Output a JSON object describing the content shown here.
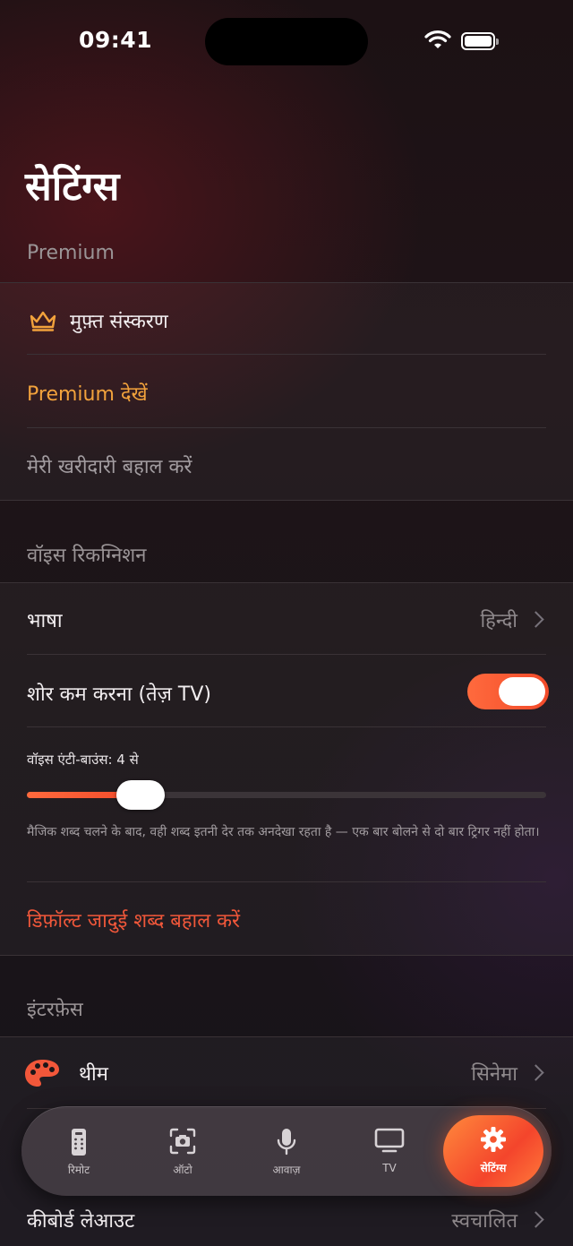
{
  "status_bar": {
    "time": "09:41"
  },
  "page": {
    "title": "सेटिंग्स"
  },
  "premium": {
    "header": "Premium",
    "version": "मुफ़्त संस्करण",
    "view_premium": "Premium देखें",
    "restore": "मेरी खरीदारी बहाल करें"
  },
  "voice": {
    "header": "वॉइस रिकग्निशन",
    "language_label": "भाषा",
    "language_value": "हिन्दी",
    "noise_label": "शोर कम करना (तेज़ TV)",
    "noise_enabled": true,
    "antibounce_label": "वॉइस एंटी-बाउंस: 4 से",
    "antibounce_fraction": 0.19,
    "antibounce_note": "मैजिक शब्द चलने के बाद, वही शब्द इतनी देर तक अनदेखा रहता है — एक बार बोलने से दो बार ट्रिगर नहीं होता।",
    "reset_magic": "डिफ़ॉल्ट जादुई शब्द बहाल करें"
  },
  "interface": {
    "header": "इंटरफ़ेस",
    "theme_label": "थीम",
    "theme_value": "सिनेमा",
    "keyboard_label": "कीबोर्ड लेआउट",
    "keyboard_value": "स्वचालित"
  },
  "tabs": [
    {
      "label": "रिमोट",
      "icon": "remote-icon"
    },
    {
      "label": "ऑटो",
      "icon": "camera-scan-icon"
    },
    {
      "label": "आवाज़",
      "icon": "microphone-icon"
    },
    {
      "label": "TV",
      "icon": "tv-icon"
    },
    {
      "label": "सेटिंग्स",
      "icon": "gear-icon",
      "active": true
    }
  ],
  "colors": {
    "accent": "#f2573a",
    "premium_orange": "#f2a23c",
    "crown": "#f2a23c",
    "palette": "#f2573a"
  }
}
